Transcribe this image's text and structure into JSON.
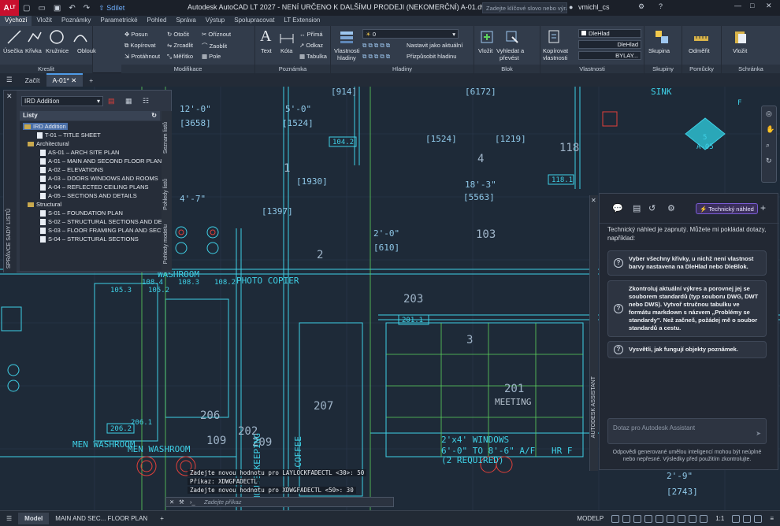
{
  "titlebar": {
    "app_badge": "A",
    "app_badge_sub": "LT",
    "share_label": "Sdílet",
    "title": "Autodesk AutoCAD LT 2027 - NENÍ URČENO K DALŠÍMU PRODEJI (NEKOMERČNÍ)    A-01.dwg - Pouze ke čtení",
    "search_placeholder": "Zadejte klíčové slovo nebo výraz.",
    "username": "vmichl_cs"
  },
  "ribbon_tabs": [
    "Výchozí",
    "Vložit",
    "Poznámky",
    "Parametrické",
    "Pohled",
    "Správa",
    "Výstup",
    "Spolupracovat",
    "LT Extension"
  ],
  "ribbon": {
    "kreslit": {
      "title": "Kreslit",
      "usecka": "Úsečka",
      "krivka": "Křivka",
      "kruznice": "Kružnice",
      "oblouk": "Oblouk"
    },
    "modifikace": {
      "title": "Modifikace",
      "posun": "Posun",
      "otocit": "Otočit",
      "oriznout": "Oříznout",
      "kopirovat": "Kopírovat",
      "zrcadlit": "Zrcadlit",
      "zaoblit": "Zaoblit",
      "protahnout": "Protáhnout",
      "meritko": "Měřítko",
      "pole": "Pole"
    },
    "poznamka": {
      "title": "Poznámka",
      "text": "Text",
      "kota": "Kóta",
      "prima": "Přímá",
      "odkaz": "Odkaz",
      "tabulka": "Tabulka"
    },
    "hladiny": {
      "title": "Hladiny",
      "vlastnosti": "Vlastnosti",
      "hladiny_label": "hladiny",
      "current": "0",
      "nastavit": "Nastavit jako aktuální",
      "prizpusobit": "Přizpůsobit hladinu"
    },
    "blok": {
      "title": "Blok",
      "vlozit": "Vložit",
      "vyhledat": "Vyhledat a",
      "prevest": "převést"
    },
    "vlastnosti": {
      "title": "Vlastnosti",
      "kopirovat": "Kopírovat",
      "vlastnosti": "vlastnosti",
      "color": "DleHlad",
      "linetype": "DleHlad",
      "lineweight": "BYLAY..."
    },
    "skupiny": {
      "title": "Skupiny",
      "skupina": "Skupina"
    },
    "pomucky": {
      "title": "Pomůcky",
      "odmerit": "Odměřit"
    },
    "schranka": {
      "title": "Schránka",
      "vlozit": "Vložit"
    }
  },
  "doc_tabs": {
    "start": "Začít",
    "active": "A-01*"
  },
  "sheetset": {
    "selector": "IRD Addition",
    "header": "Listy",
    "side_label": "SPRÁVCE SADY LISTŮ",
    "vtabs": [
      "Seznam listů",
      "Pohledy listů",
      "Pohledy modelu"
    ],
    "root": "IRD Addition",
    "title_sheet": "T-01 – TITLE SHEET",
    "groups": [
      {
        "name": "Architectural",
        "sheets": [
          "AS-01 – ARCH SITE PLAN",
          "A-01 – MAIN AND SECOND FLOOR PLAN",
          "A-02 – ELEVATIONS",
          "A-03 – DOORS WINDOWS AND ROOMS",
          "A-04 – REFLECTED CEILING PLANS",
          "A-05 – SECTIONS AND DETAILS"
        ]
      },
      {
        "name": "Structural",
        "sheets": [
          "S-01 – FOUNDATION PLAN",
          "S-02 – STRUCTURAL SECTIONS AND DETAI",
          "S-03 – FLOOR FRAMING PLAN AND SECTIC",
          "S-04 – STRUCTURAL SECTIONS"
        ]
      }
    ]
  },
  "drawing": {
    "dims": [
      "12'-0\"",
      "[3658]",
      "5'-0\"",
      "[1524]",
      "[914]",
      "[6172]",
      "[1930]",
      "18'-3\"",
      "[5563]",
      "4'-7\"",
      "[1397]",
      "2'-0\"",
      "[610]",
      "[1219]",
      "[1524]",
      "2'-9\"",
      "[2743]"
    ],
    "tags": [
      "104.2",
      "118.1",
      "108.4",
      "108.3",
      "108.2",
      "105.3",
      "105.2",
      "201.1",
      "206.2",
      "206.1",
      "F",
      "A-05",
      "5"
    ],
    "numbers": [
      "118",
      "103",
      "203",
      "207",
      "206",
      "209",
      "109",
      "202",
      "201",
      "3",
      "4",
      "2",
      "1"
    ],
    "labels": [
      "SINK",
      "WASHROOM",
      "PHOTO COPIER",
      "MEN WASHROOM",
      "MEN WASHROOM",
      "HOUSE KEEPING",
      "COFFEE",
      "MEETING",
      "2'x4' WINDOWS",
      "6'-0\" TO 8'-6\" A/F",
      "(2 REQUIRED)",
      "HR F"
    ]
  },
  "assistant": {
    "badge": "Technický náhled",
    "side_label": "AUTODESK ASSISTANT",
    "intro": "Technický náhled je zapnutý. Můžete mi pokládat dotazy, například:",
    "suggestions": [
      "Vyber všechny křivky, u nichž není vlastnost barvy nastavena na DleHlad nebo DleBlok.",
      "Zkontroluj aktuální výkres a porovnej jej se souborem standardů (typ souboru DWG, DWT nebo DWS). Vytvoř stručnou tabulku ve formátu markdown s názvem „Problémy se standardy\". Než začneš, požádej mě o soubor standardů a cestu.",
      "Vysvětli, jak fungují objekty poznámek."
    ],
    "input_placeholder": "Dotaz pro Autodesk Assistant",
    "footer": "Odpovědi generované umělou inteligencí mohou být neúplné nebo nepřesné. Výsledky před použitím zkontrolujte."
  },
  "command": {
    "history": [
      "Zadejte novou hodnotu pro LAYLOCKFADECTL <30>: 50",
      "Příkaz: XDWGFADECTL",
      "Zadejte novou hodnotu pro XDWGFADECTL <50>: 30"
    ],
    "placeholder": "Zadejte příkaz"
  },
  "status": {
    "model_tab": "Model",
    "layout_tab": "MAIN AND SEC... FLOOR PLAN",
    "modelp": "MODELP",
    "scale": "1:1"
  },
  "colors": {
    "accent": "#4e9be8",
    "cad_line": "#3fd0e6",
    "cad_dim": "#8fc8e8",
    "cad_green": "#5dd35d",
    "cad_red": "#e2403a"
  }
}
